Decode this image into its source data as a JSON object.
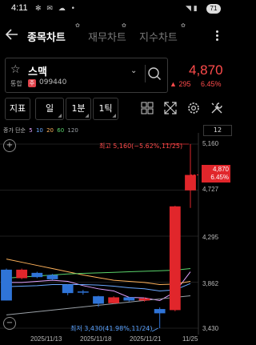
{
  "status": {
    "time": "4:11",
    "battery": "71"
  },
  "nav": {
    "tabs": [
      {
        "label": "종목차트"
      },
      {
        "label": "재무차트"
      },
      {
        "label": "지수차트"
      }
    ]
  },
  "stock": {
    "name": "스맥",
    "market": "통합",
    "badge": "주",
    "code": "099440",
    "price": "4,870",
    "change_arrow": "▲",
    "change": "295",
    "change_pct": "6.45%"
  },
  "toolbar": {
    "indicator": "지표",
    "period_day": "일",
    "period_min": "1분",
    "period_tick": "1틱"
  },
  "colors": {
    "up": "#e1262b",
    "down": "#2f74d8",
    "ma5": "#e0a2ff",
    "ma10": "#6aa8ff",
    "ma20": "#ffb25b",
    "ma60": "#5ad36b",
    "ma120": "#9aa0a6"
  },
  "chart_data": {
    "type": "candlestick",
    "legend_prefix": "종가 단순",
    "legend": [
      "5",
      "10",
      "20",
      "60",
      "120"
    ],
    "level_box": "12",
    "y_ticks": [
      "5,160",
      "4,727",
      "4,295",
      "3,862",
      "3,430"
    ],
    "x_ticks": [
      "2025/11/13",
      "2025/11/18",
      "2025/11/21",
      "11/25"
    ],
    "high_label": "최고 5,160(−5.62%,11/25)",
    "low_label": "최저 3,430(41.98%,11/24)",
    "current_price": "4,870",
    "current_pct": "6.45%",
    "ylim": [
      3430,
      5160
    ],
    "candles": [
      {
        "o": 3980,
        "c": 3690,
        "h": 3990,
        "l": 3690
      },
      {
        "o": 3900,
        "c": 3980,
        "h": 3990,
        "l": 3890
      },
      {
        "o": 3950,
        "c": 3910,
        "h": 3960,
        "l": 3900
      },
      {
        "o": 3930,
        "c": 3890,
        "h": 3940,
        "l": 3880
      },
      {
        "o": 3840,
        "c": 3760,
        "h": 3845,
        "l": 3740
      },
      {
        "o": 3775,
        "c": 3765,
        "h": 3790,
        "l": 3745
      },
      {
        "o": 3730,
        "c": 3660,
        "h": 3735,
        "l": 3630
      },
      {
        "o": 3665,
        "c": 3720,
        "h": 3730,
        "l": 3660
      },
      {
        "o": 3720,
        "c": 3690,
        "h": 3725,
        "l": 3680
      },
      {
        "o": 3690,
        "c": 3710,
        "h": 3720,
        "l": 3680
      },
      {
        "o": 3610,
        "c": 3570,
        "h": 3625,
        "l": 3430
      },
      {
        "o": 3600,
        "c": 4575,
        "h": 4580,
        "l": 3590
      },
      {
        "o": 4725,
        "c": 4870,
        "h": 5160,
        "l": 4560
      }
    ],
    "series": [
      {
        "name": "5",
        "values": [
          3860,
          3860,
          3870,
          3880,
          3870,
          3830,
          3800,
          3780,
          3720,
          3715,
          3690,
          3770,
          3960
        ]
      },
      {
        "name": "10",
        "values": [
          3820,
          3825,
          3830,
          3840,
          3840,
          3840,
          3835,
          3825,
          3810,
          3800,
          3780,
          3790,
          3850
        ]
      },
      {
        "name": "20",
        "values": [
          4080,
          4050,
          4020,
          3990,
          3960,
          3930,
          3905,
          3880,
          3870,
          3860,
          3840,
          3845,
          3870
        ]
      },
      {
        "name": "60",
        "values": [
          3900,
          3910,
          3920,
          3930,
          3940,
          3945,
          3950,
          3955,
          3960,
          3965,
          3970,
          3975,
          3990
        ]
      },
      {
        "name": "120",
        "values": [
          3555,
          3570,
          3585,
          3600,
          3615,
          3630,
          3645,
          3660,
          3675,
          3690,
          3705,
          3720,
          3735
        ]
      }
    ]
  }
}
